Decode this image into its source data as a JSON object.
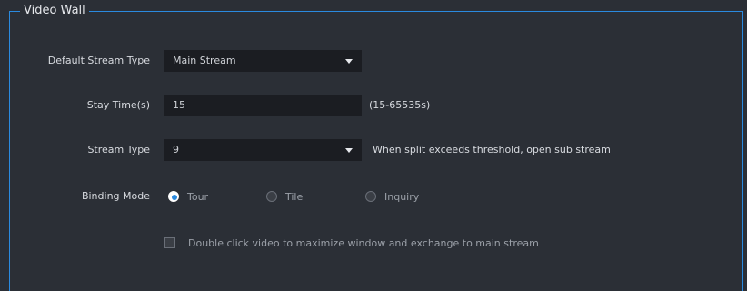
{
  "section": {
    "title": "Video Wall"
  },
  "default_stream_type": {
    "label": "Default Stream Type",
    "value": "Main Stream"
  },
  "stay_time": {
    "label": "Stay Time(s)",
    "value": "15",
    "hint": "(15-65535s)"
  },
  "stream_type": {
    "label": "Stream Type",
    "value": "9",
    "hint": "When split exceeds threshold, open sub stream"
  },
  "binding_mode": {
    "label": "Binding Mode",
    "options": [
      {
        "label": "Tour",
        "checked": true
      },
      {
        "label": "Tile",
        "checked": false
      },
      {
        "label": "Inquiry",
        "checked": false
      }
    ]
  },
  "double_click_option": {
    "label": "Double click video to maximize window and exchange to main stream",
    "checked": false
  },
  "colors": {
    "background": "#2b2f36",
    "accent": "#2a8adf",
    "input_bg": "#1b1d22"
  }
}
